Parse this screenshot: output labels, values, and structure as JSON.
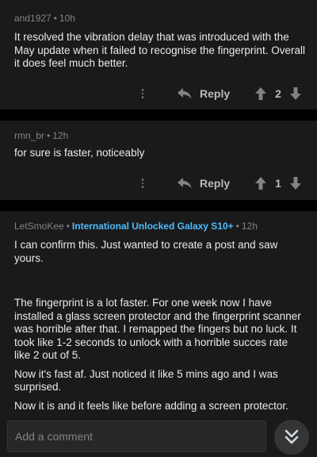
{
  "comments": [
    {
      "author": "and1927",
      "age": "10h",
      "paragraphs": [
        "It resolved the vibration delay that was introduced with the May update when it failed to recognise the fingerprint. Overall it does feel much better."
      ],
      "reply_label": "Reply",
      "score": "2"
    },
    {
      "author": "rmn_br",
      "age": "12h",
      "paragraphs": [
        "for sure is faster, noticeably"
      ],
      "reply_label": "Reply",
      "score": "1"
    },
    {
      "author": "LetSmoKee",
      "flair": "International Unlocked Galaxy S10+",
      "age": "12h",
      "paragraphs": [
        "I can confirm this. Just wanted to create a post and saw yours.",
        "The fingerprint is a lot faster. For one week now I have installed a glass screen protector and the fingerprint scanner was horrible after that. I remapped the fingers but no luck. It took like 1-2 seconds to unlock with a horrible succes rate like 2 out of 5.",
        "Now it's fast af. Just noticed it like 5 mins ago and I was surprised.",
        "Now it is and it feels like before adding a screen protector."
      ]
    }
  ],
  "separator": "•",
  "composer": {
    "placeholder": "Add a comment"
  },
  "icons": {
    "more": "more-vertical-icon",
    "reply": "reply-arrow-icon",
    "upvote": "upvote-arrow-icon",
    "downvote": "downvote-arrow-icon",
    "jump": "double-chevron-down-icon"
  },
  "colors": {
    "background": "#000000",
    "card": "#1a1a1b",
    "text": "#e8eaec",
    "meta": "#818384",
    "flair": "#4fbcff",
    "input": "#272729"
  }
}
